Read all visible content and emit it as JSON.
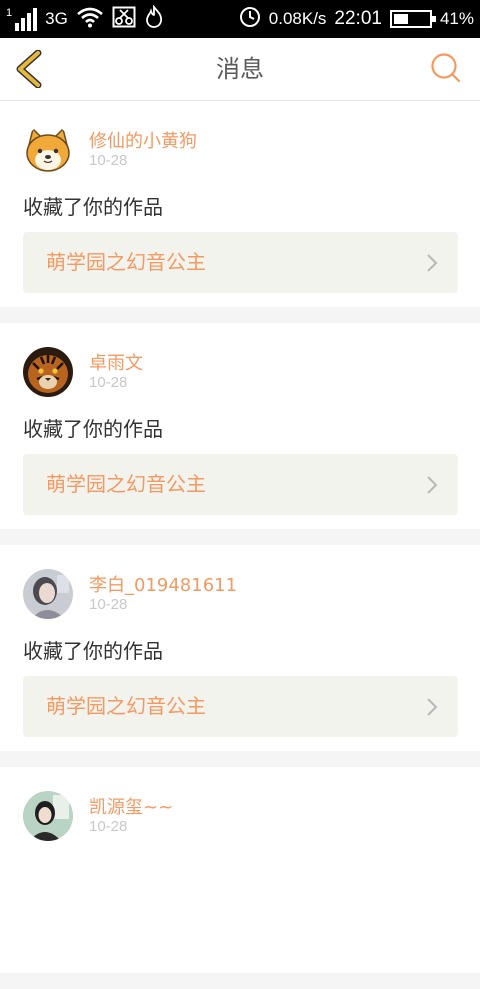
{
  "status_bar": {
    "sim_number": "1",
    "network": "3G",
    "speed": "0.08K/s",
    "time": "22:01",
    "battery_percent": "41%",
    "battery_level": 0.41
  },
  "header": {
    "title": "消息"
  },
  "messages": [
    {
      "username": "修仙的小黄狗",
      "date": "10-28",
      "text": "收藏了你的作品",
      "work_title": "萌学园之幻音公主",
      "avatar": "shiba-dog"
    },
    {
      "username": "卓雨文",
      "date": "10-28",
      "text": "收藏了你的作品",
      "work_title": "萌学园之幻音公主",
      "avatar": "tiger"
    },
    {
      "username": "李白_019481611",
      "date": "10-28",
      "text": "收藏了你的作品",
      "work_title": "萌学园之幻音公主",
      "avatar": "girl-photo"
    },
    {
      "username": "凯源玺~~",
      "date": "10-28",
      "text": "",
      "work_title": "",
      "avatar": "person-photo"
    }
  ],
  "colors": {
    "accent": "#f39a63",
    "back_arrow": "#e6b83c",
    "status_bar_bg": "#000000",
    "card_bg": "#ffffff",
    "work_bg": "#f3f3ee"
  }
}
